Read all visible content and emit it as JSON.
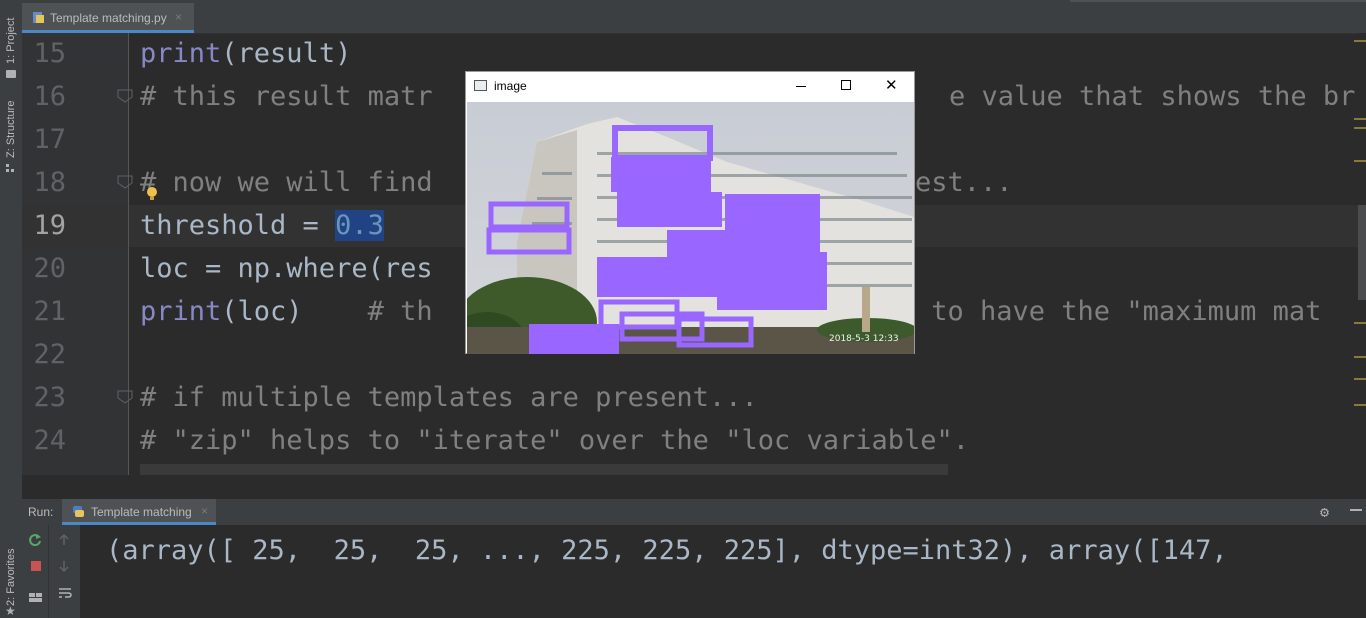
{
  "editor": {
    "tab_label": "Template matching.py",
    "tab_close": "×",
    "lines": [
      {
        "num": "15"
      },
      {
        "num": "16"
      },
      {
        "num": "17"
      },
      {
        "num": "18"
      },
      {
        "num": "19"
      },
      {
        "num": "20"
      },
      {
        "num": "21"
      },
      {
        "num": "22"
      },
      {
        "num": "23"
      },
      {
        "num": "24"
      }
    ],
    "code": {
      "l15_fn": "print",
      "l15_rest": "(result)",
      "l16": "# this result matr",
      "l16b": "e value that shows the br",
      "l18": "# now we will find",
      "l18b": "est...",
      "l19_pre": "threshold = ",
      "l19_val": "0.3",
      "l20": "loc = np.where(res",
      "l21_fn": "print",
      "l21_rest": "(loc)",
      "l21_cm": "# th",
      "l21b": " to have the \"maximum mat",
      "l23": "# if multiple templates are present...",
      "l24": "# \"zip\" helps to \"iterate\" over the \"loc variable\"."
    }
  },
  "left_tabs": {
    "project": "1: Project",
    "structure": "Z: Structure",
    "favorites": "2: Favorites"
  },
  "run_panel": {
    "run_label": "Run:",
    "tab_label": "Template matching",
    "tab_close": "×",
    "output": "(array([ 25,  25,  25, ..., 225, 225, 225], dtype=int32), array([147, "
  },
  "image_window": {
    "title": "image",
    "close_glyph": "✕",
    "timestamp": "2018-5-3 12:33"
  },
  "colors": {
    "bg": "#2b2b2b",
    "keyword": "#8888c6",
    "comment": "#808080",
    "number": "#6897bb",
    "selection": "#214283",
    "box_purple": "#9966ff"
  }
}
